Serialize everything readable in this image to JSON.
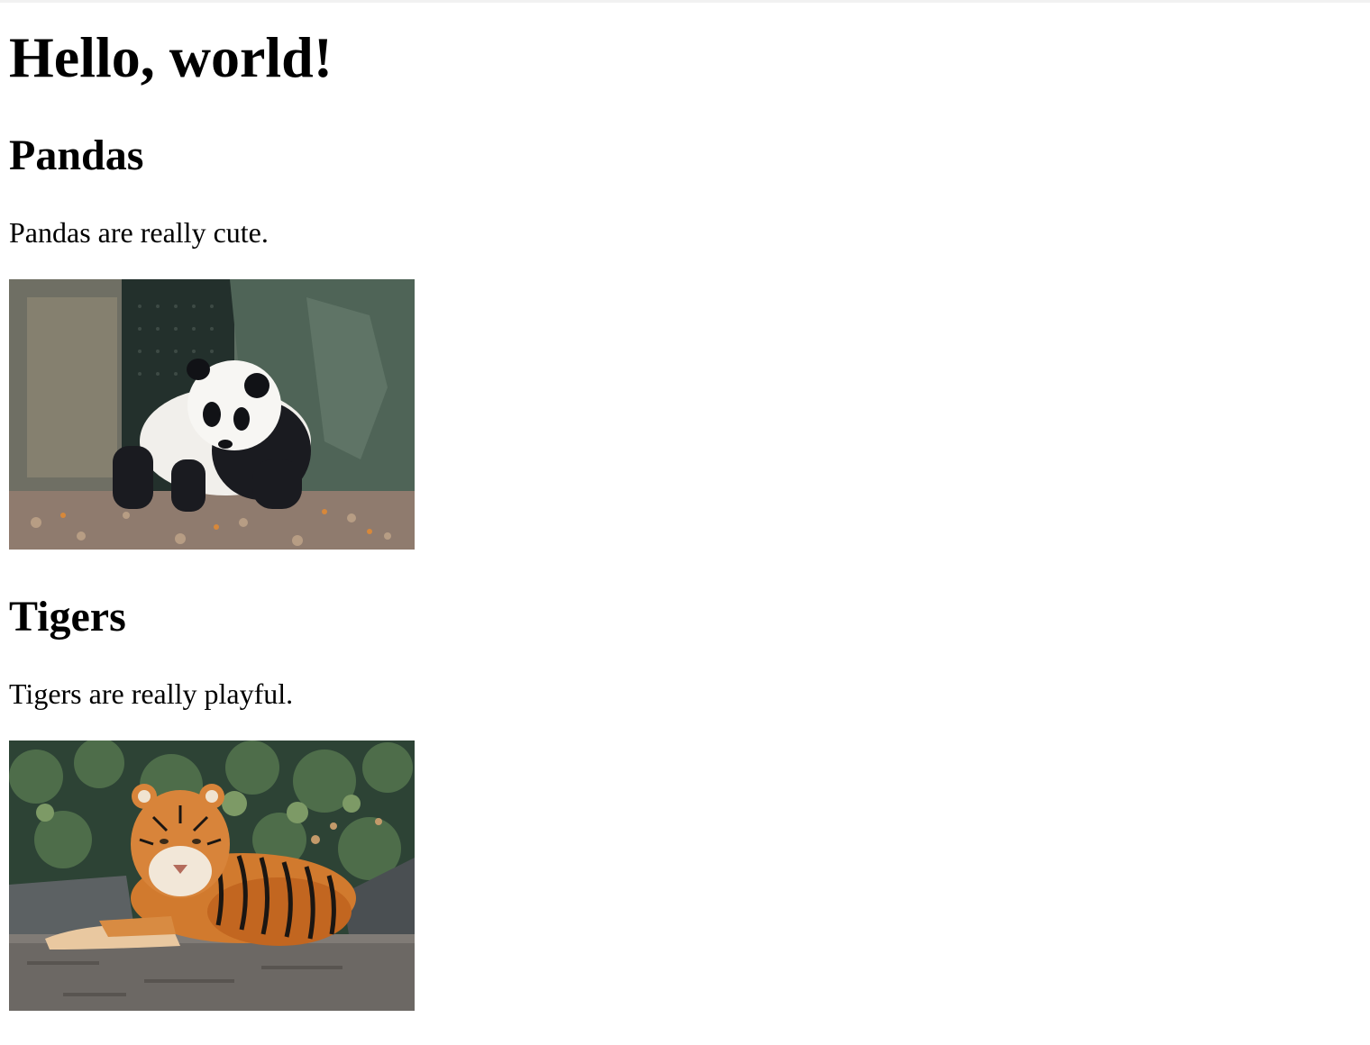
{
  "page": {
    "title": "Hello, world!"
  },
  "sections": [
    {
      "heading": "Pandas",
      "text": "Pandas are really cute.",
      "image": {
        "subject": "giant panda walking on leaves in front of rock enclosure"
      }
    },
    {
      "heading": "Tigers",
      "text": "Tigers are really playful.",
      "image": {
        "subject": "tiger lying on a rock in front of foliage"
      }
    }
  ],
  "colors": {
    "background": "#ffffff",
    "text": "#000000"
  }
}
